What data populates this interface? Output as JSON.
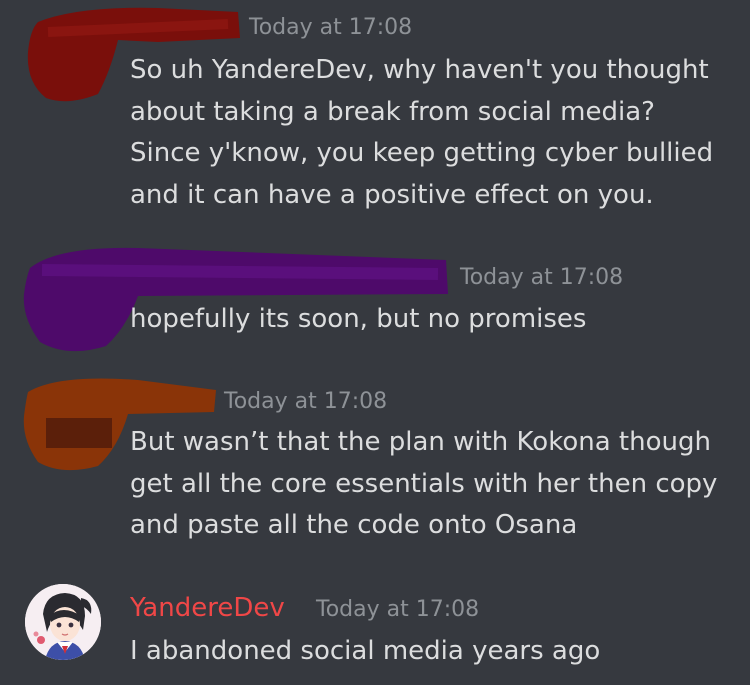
{
  "colors": {
    "background": "#36393f",
    "message_text": "#dcddde",
    "timestamp": "#8e9297",
    "username_red": "#f04747"
  },
  "messages": [
    {
      "author_redacted": true,
      "timestamp": "Today at 17:08",
      "lines": [
        "So uh YandereDev, why haven't you thought",
        "about taking a break from social media?",
        "Since y'know, you keep getting cyber bullied",
        "and it can have a positive effect on you."
      ]
    },
    {
      "author_redacted": true,
      "timestamp": "Today at 17:08",
      "lines": [
        "hopefully its soon, but no promises"
      ]
    },
    {
      "author_redacted": true,
      "timestamp": "Today at 17:08",
      "lines": [
        "But wasn’t that the plan with Kokona though",
        "get all the core essentials with her then copy",
        "and paste all the code onto Osana"
      ]
    },
    {
      "author": "YandereDev",
      "timestamp": "Today at 17:08",
      "lines": [
        "I abandoned social media years ago"
      ]
    }
  ]
}
